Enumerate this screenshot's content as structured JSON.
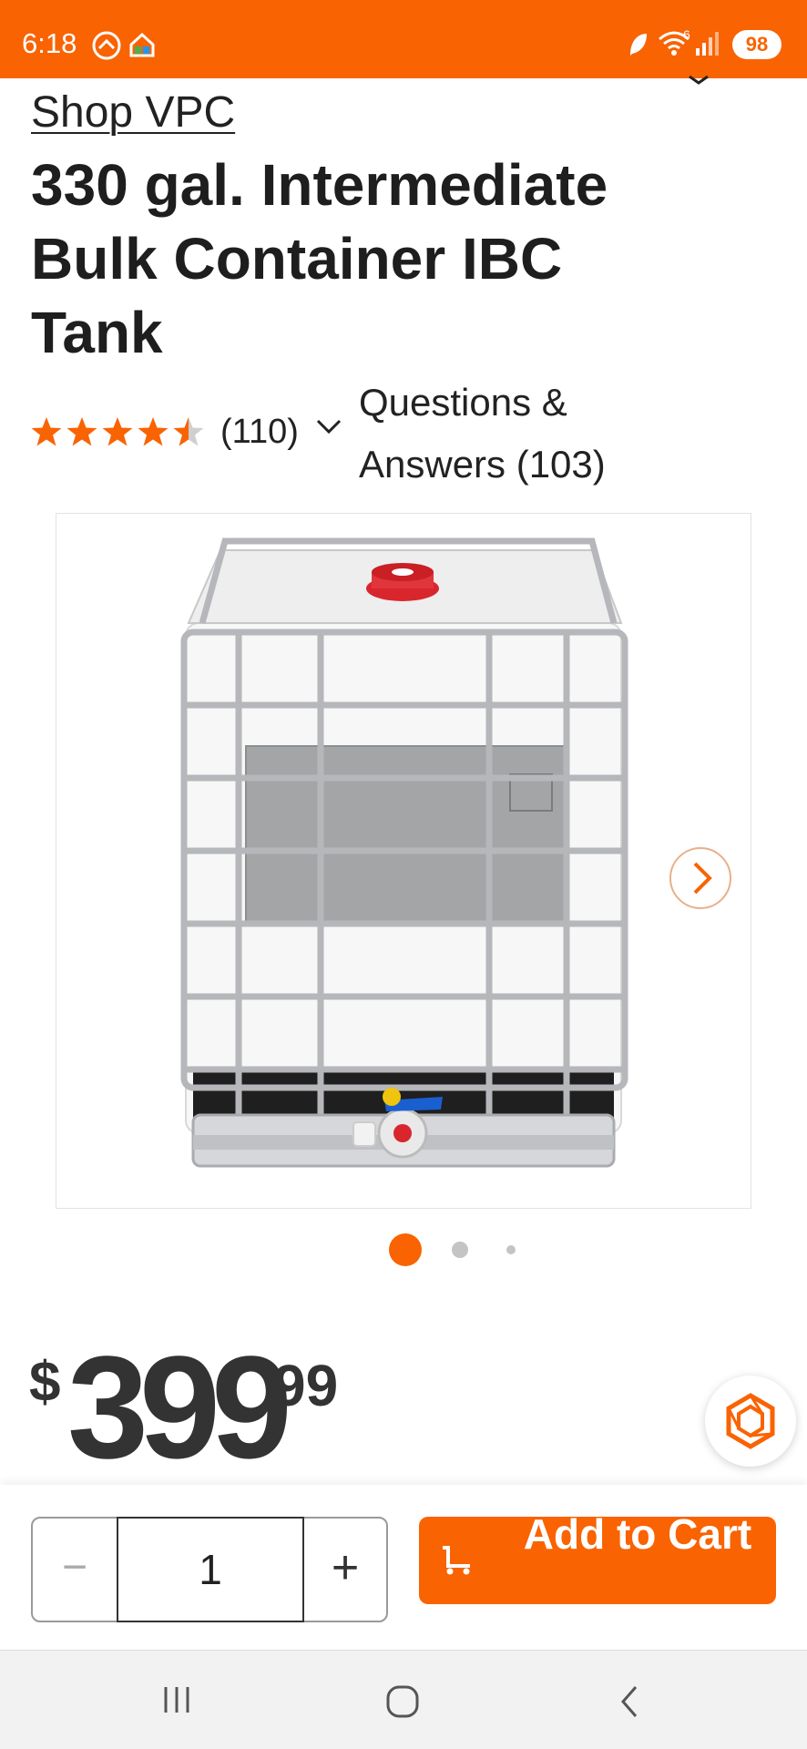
{
  "status_bar": {
    "time": "6:18",
    "battery": "98",
    "network": "6",
    "background_color": "#f96302"
  },
  "breadcrumb": {
    "brand_link": "Shop VPC"
  },
  "product": {
    "title": "330 gal. Intermediate Bulk Container IBC Tank",
    "rating_value": 4.5,
    "rating_max": 5,
    "review_count": "(110)",
    "qa_label": "Questions & Answers (103)",
    "image_alt_icon": "ibc-tank-image"
  },
  "gallery": {
    "total_images": 3,
    "active_index": 0
  },
  "price": {
    "currency": "$",
    "dollars": "399",
    "cents": "99"
  },
  "purchase": {
    "quantity": "1",
    "minus_symbol": "−",
    "plus_symbol": "+",
    "add_to_cart_label": "Add to Cart"
  },
  "colors": {
    "brand_orange": "#f96302",
    "text_dark": "#222222"
  }
}
